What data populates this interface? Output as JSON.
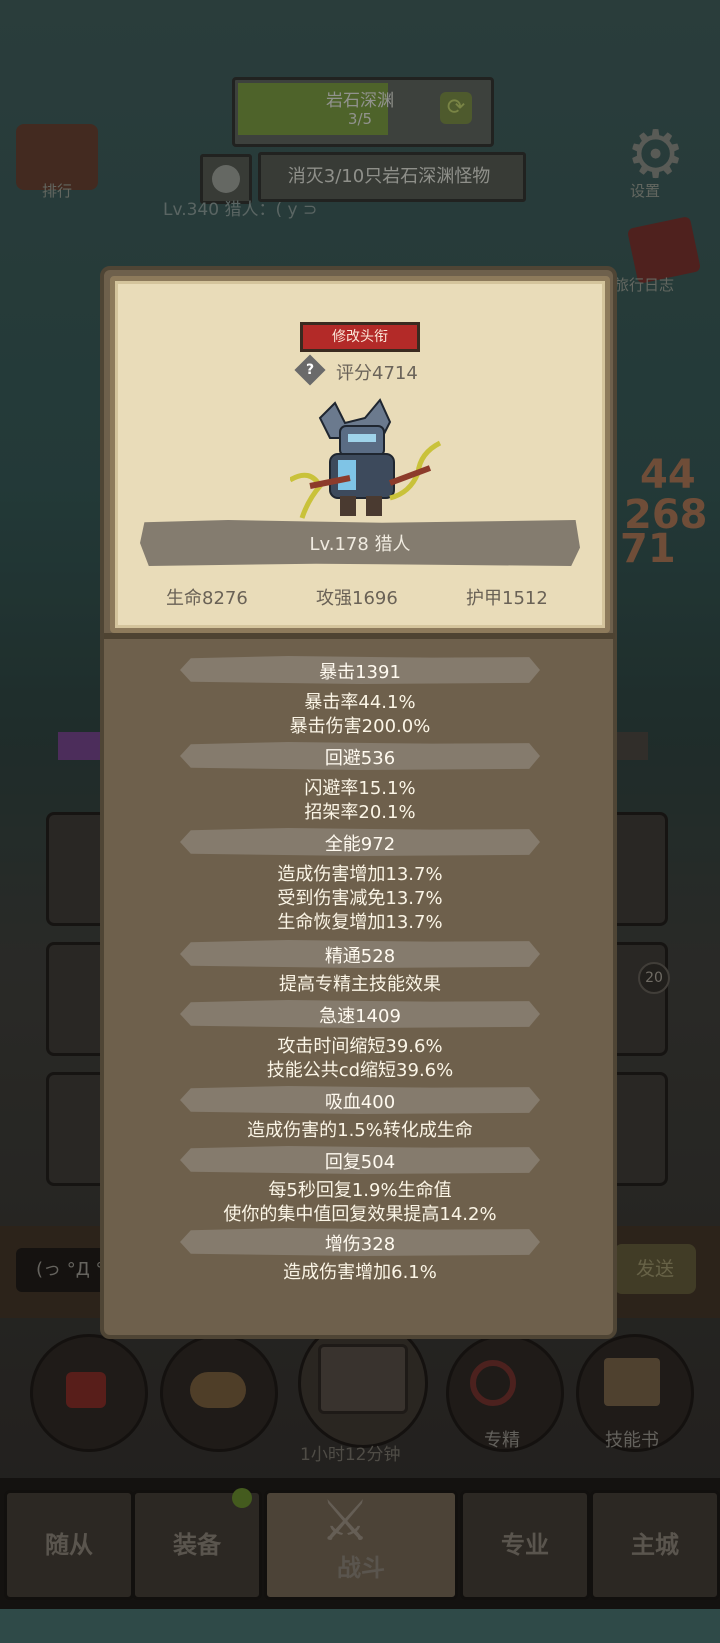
{
  "hud": {
    "stage_name": "岩石深渊",
    "stage_progress": "3/5",
    "quest": "消灭3/10只岩石深渊怪物",
    "hunter_line": "Lv.340 猎人：(   y  ⊃ ",
    "left_menu_label": "排行",
    "settings_label": "设置",
    "log_label": "旅行日志",
    "damage_numbers": [
      "44",
      "268",
      "71"
    ]
  },
  "modal": {
    "edit_title_button": "修改头衔",
    "score": "评分4714",
    "character_name": "Lv.178 猎人",
    "base_stats": [
      "生命8276",
      "攻强1696",
      "护甲1512"
    ],
    "sections": [
      {
        "head": "暴击1391",
        "lines": [
          "暴击率44.1%",
          "暴击伤害200.0%"
        ]
      },
      {
        "head": "回避536",
        "lines": [
          "闪避率15.1%",
          "招架率20.1%"
        ]
      },
      {
        "head": "全能972",
        "lines": [
          "造成伤害增加13.7%",
          "受到伤害减免13.7%",
          "生命恢复增加13.7%"
        ]
      },
      {
        "head": "精通528",
        "lines": [
          "提高专精主技能效果"
        ]
      },
      {
        "head": "急速1409",
        "lines": [
          "攻击时间缩短39.6%",
          "技能公共cd缩短39.6%"
        ]
      },
      {
        "head": "吸血400",
        "lines": [
          "造成伤害的1.5%转化成生命"
        ]
      },
      {
        "head": "回复504",
        "lines": [
          "每5秒回复1.9%生命值",
          "使你的集中值回复效果提高14.2%"
        ]
      },
      {
        "head": "增伤328",
        "lines": [
          "造成伤害增加6.1%"
        ]
      }
    ]
  },
  "chat": {
    "input_text": "(っ °Д °",
    "send_label": "发送"
  },
  "actions": {
    "timer": "1小时12分钟",
    "specialization_label": "专精",
    "skillbook_label": "技能书",
    "badge_count": "20"
  },
  "tabs": [
    "随从",
    "装备",
    "战斗",
    "专业",
    "主城"
  ]
}
